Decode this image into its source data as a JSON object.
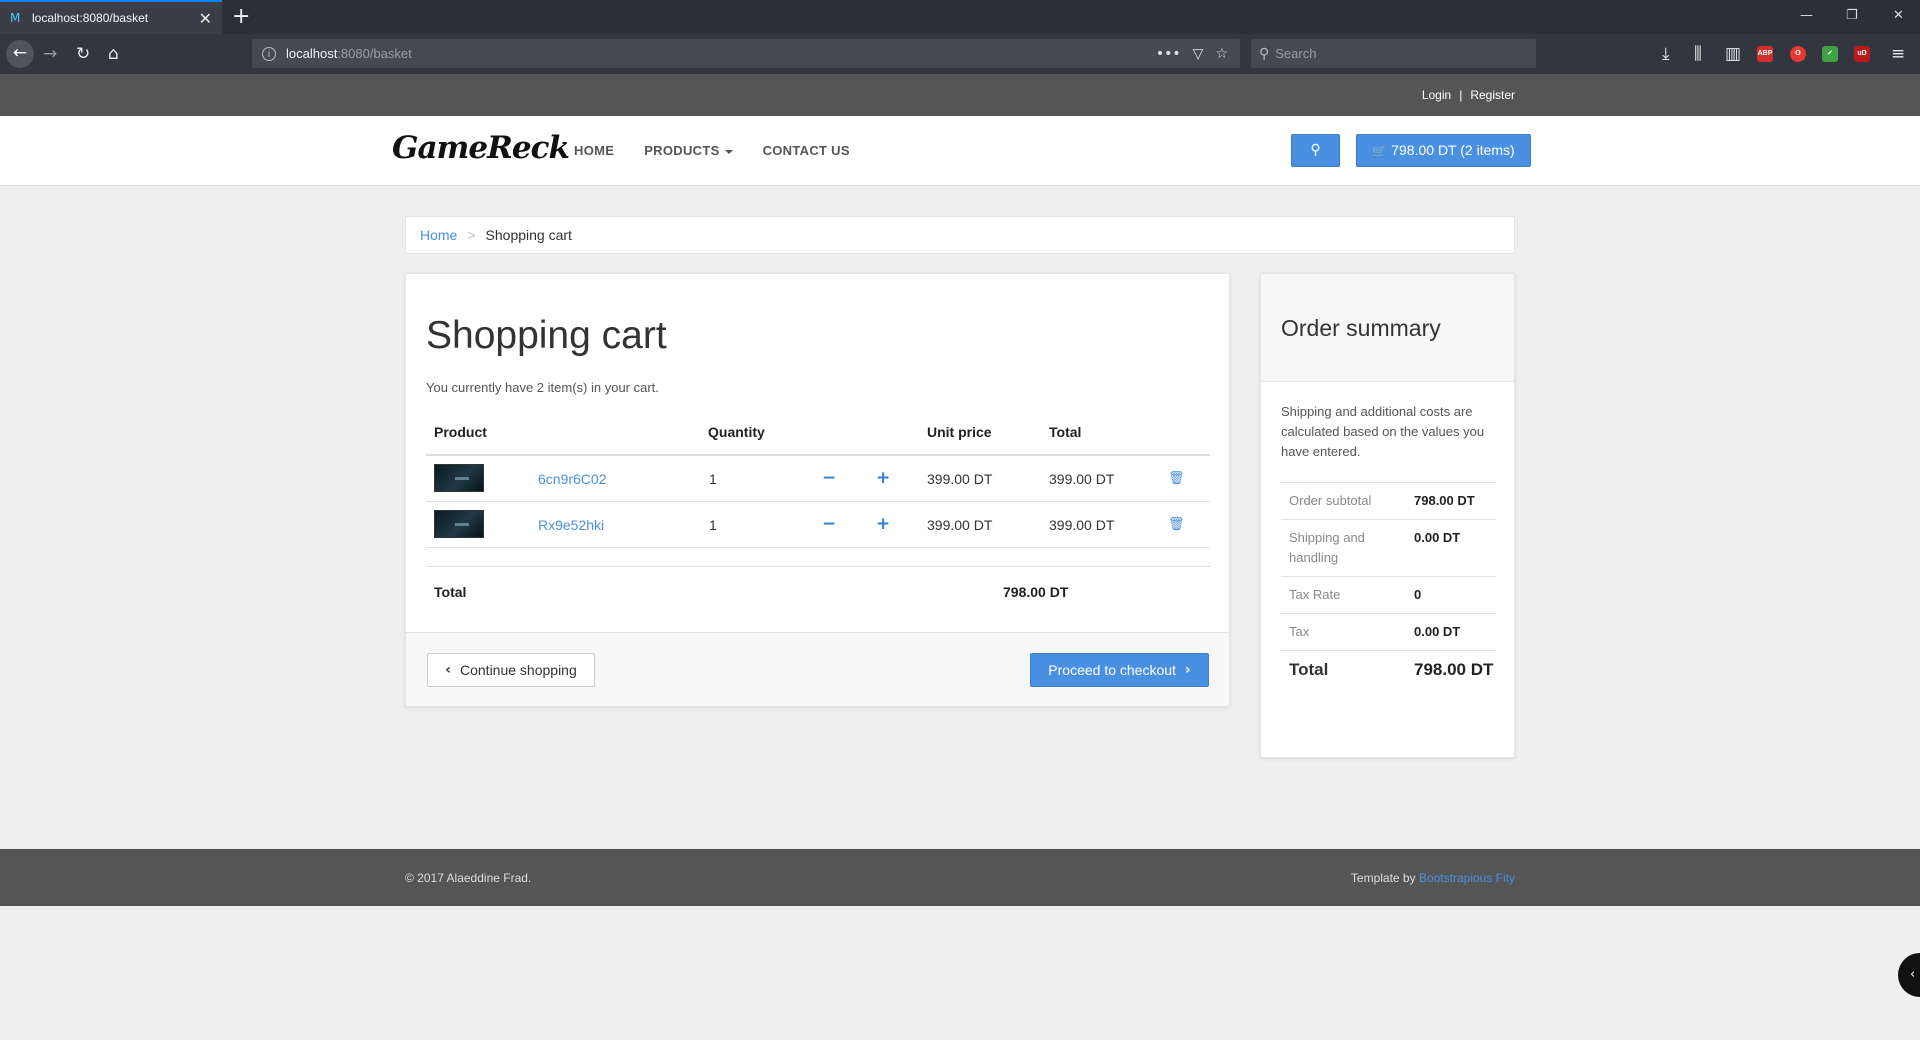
{
  "browser": {
    "tab_title": "localhost:8080/basket",
    "url_host": "localhost",
    "url_rest": ":8080/basket",
    "search_placeholder": "Search",
    "ext_abp": "ABP",
    "ext_ub": "uD"
  },
  "topbar": {
    "login": "Login",
    "separator": "|",
    "register": "Register"
  },
  "header": {
    "logo": "GameReck",
    "nav": [
      "HOME",
      "PRODUCTS",
      "CONTACT US"
    ],
    "cart_button": "798.00 DT (2 items)"
  },
  "breadcrumb": {
    "home": "Home",
    "separator": ">",
    "current": "Shopping cart"
  },
  "cart": {
    "title": "Shopping cart",
    "subtitle": "You currently have 2 item(s) in your cart.",
    "columns": {
      "product": "Product",
      "quantity": "Quantity",
      "unit_price": "Unit price",
      "total": "Total"
    },
    "items": [
      {
        "name": "6cn9r6C02",
        "quantity": "1",
        "unit_price": "399.00 DT",
        "total": "399.00 DT"
      },
      {
        "name": "Rx9e52hki",
        "quantity": "1",
        "unit_price": "399.00 DT",
        "total": "399.00 DT"
      }
    ],
    "total_label": "Total",
    "total_value": "798.00 DT",
    "continue_button": "Continue shopping",
    "checkout_button": "Proceed to checkout"
  },
  "summary": {
    "title": "Order summary",
    "text": "Shipping and additional costs are calculated based on the values you have entered.",
    "rows": [
      {
        "label": "Order subtotal",
        "value": "798.00 DT"
      },
      {
        "label": "Shipping and handling",
        "value": "0.00 DT"
      },
      {
        "label": "Tax Rate",
        "value": "0"
      },
      {
        "label": "Tax",
        "value": "0.00 DT"
      }
    ],
    "total_label": "Total",
    "total_value": "798.00 DT"
  },
  "footer": {
    "copyright": "© 2017 Alaeddine Frad.",
    "template_prefix": "Template by",
    "template_link": "Bootstrapious Fity"
  },
  "colors": {
    "accent": "#4a90e2",
    "browser_dark": "#2c2f36",
    "topbar": "#555555"
  }
}
